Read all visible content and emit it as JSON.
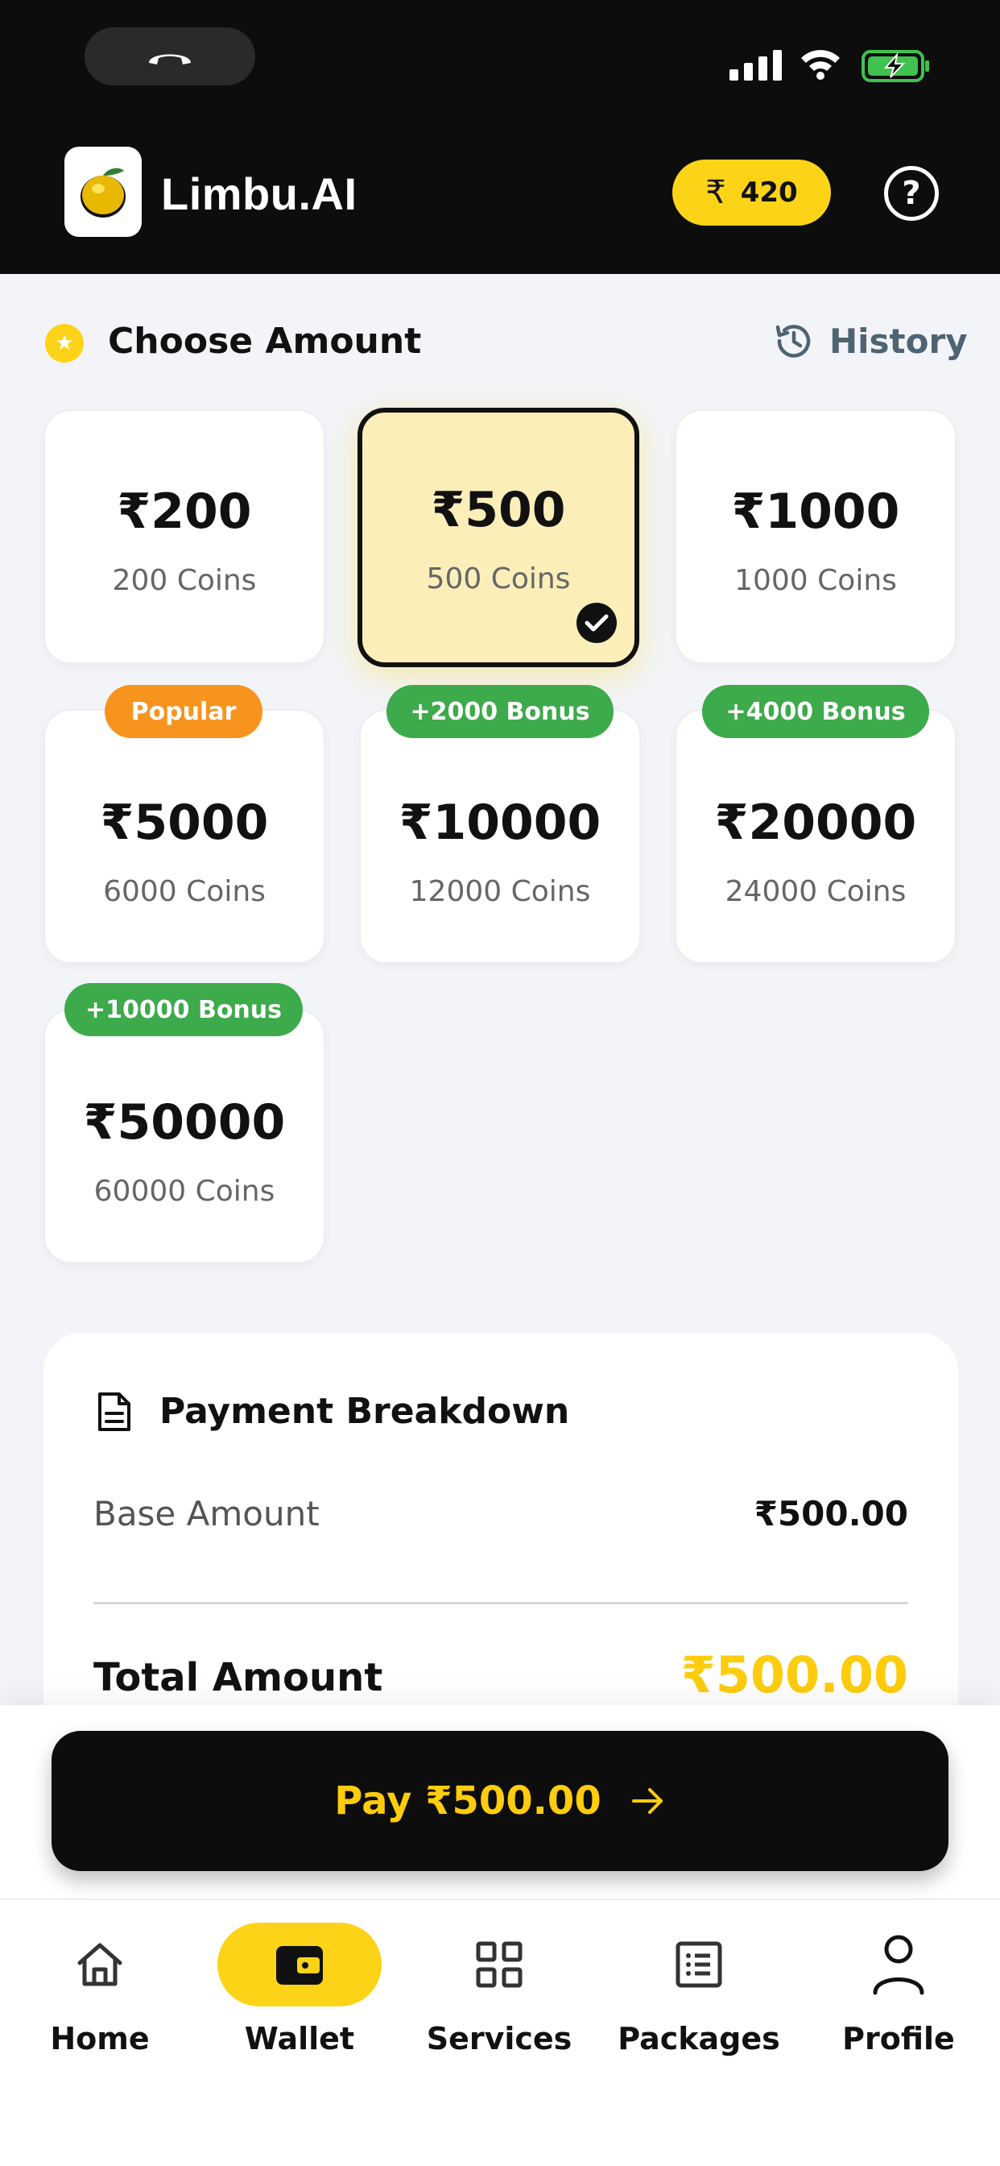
{
  "header": {
    "app_title": "Limbu.AI",
    "coin_symbol": "₹",
    "coin_balance": "420",
    "help_label": "?"
  },
  "section": {
    "title": "Choose Amount",
    "history_label": "History"
  },
  "amounts": [
    {
      "price": "₹200",
      "coins": "200 Coins",
      "badge": "",
      "selected": false
    },
    {
      "price": "₹500",
      "coins": "500 Coins",
      "badge": "",
      "selected": true
    },
    {
      "price": "₹1000",
      "coins": "1000 Coins",
      "badge": "",
      "selected": false
    },
    {
      "price": "₹5000",
      "coins": "6000 Coins",
      "badge": "Popular",
      "selected": false
    },
    {
      "price": "₹10000",
      "coins": "12000 Coins",
      "badge": "+2000 Bonus",
      "selected": false
    },
    {
      "price": "₹20000",
      "coins": "24000 Coins",
      "badge": "+4000 Bonus",
      "selected": false
    },
    {
      "price": "₹50000",
      "coins": "60000 Coins",
      "badge": "+10000 Bonus",
      "selected": false
    }
  ],
  "breakdown": {
    "title": "Payment Breakdown",
    "base_label": "Base Amount",
    "base_value": "₹500.00",
    "total_label": "Total Amount",
    "total_value": "₹500.00"
  },
  "pay_button": {
    "label": "Pay ₹500.00"
  },
  "nav": {
    "items": [
      {
        "label": "Home",
        "icon": "home-icon",
        "active": false
      },
      {
        "label": "Wallet",
        "icon": "wallet-icon",
        "active": true
      },
      {
        "label": "Services",
        "icon": "grid-icon",
        "active": false
      },
      {
        "label": "Packages",
        "icon": "list-icon",
        "active": false
      },
      {
        "label": "Profile",
        "icon": "user-icon",
        "active": false
      }
    ]
  },
  "colors": {
    "accent": "#fdd318",
    "header_bg": "#0d0d0d",
    "bonus_green": "#3daa4b",
    "popular_orange": "#f7941d",
    "total_yellow": "#fdcc0d"
  }
}
